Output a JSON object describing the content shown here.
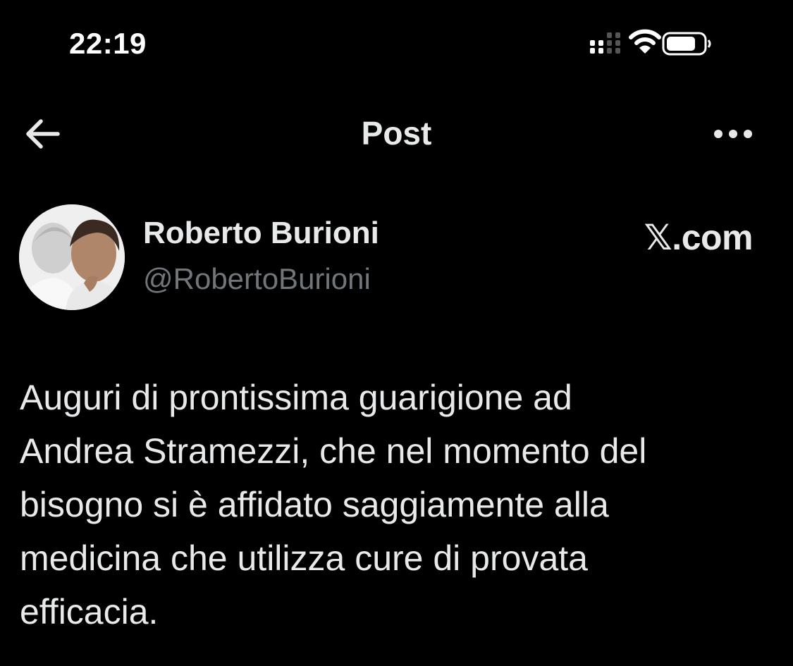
{
  "status_bar": {
    "time": "22:19",
    "icons": [
      "cellular-signal-icon",
      "wifi-icon",
      "battery-icon"
    ]
  },
  "nav": {
    "title": "Post",
    "back_icon": "arrow-left-icon",
    "more_icon": "more-horizontal-icon"
  },
  "post": {
    "author": {
      "display_name": "Roberto Burioni",
      "handle": "@RobertoBurioni"
    },
    "brand": {
      "glyph": "𝕏",
      "suffix": ".com"
    },
    "text": "Auguri di prontissima guarigione ad\nAndrea Stramezzi, che nel momento del\nbisogno si è affidato saggiamente alla\nmedicina che utilizza cure di provata\nefficacia."
  },
  "colors": {
    "background": "#000000",
    "primary_text": "#e7e9ea",
    "secondary_text": "#71767b"
  }
}
